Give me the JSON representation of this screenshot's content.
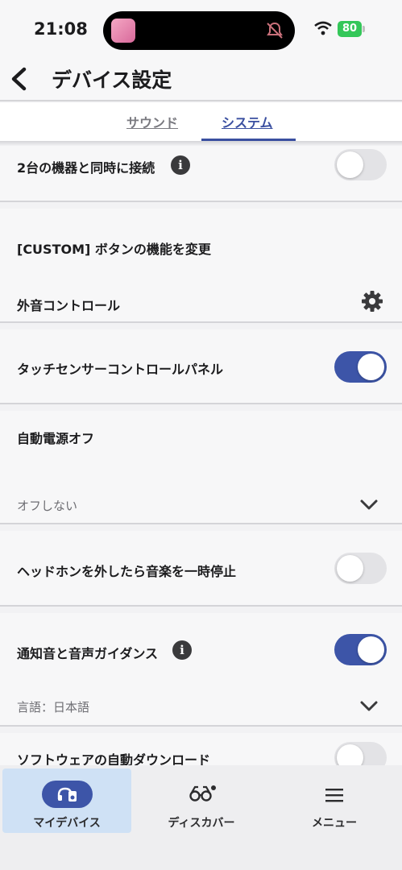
{
  "status_bar": {
    "time": "21:08",
    "battery": "80"
  },
  "header": {
    "title": "デバイス設定"
  },
  "tabs": [
    {
      "label": "サウンド",
      "active": false
    },
    {
      "label": "システム",
      "active": true
    }
  ],
  "settings": {
    "dual_connect": {
      "label": "2台の機器と同時に接続",
      "enabled": false
    },
    "custom_button": {
      "label": "[CUSTOM] ボタンの機能を変更"
    },
    "ambient_control": {
      "label": "外音コントロール"
    },
    "touch_panel": {
      "label": "タッチセンサーコントロールパネル",
      "enabled": true
    },
    "auto_power_off": {
      "label": "自動電源オフ",
      "value": "オフしない"
    },
    "pause_on_remove": {
      "label": "ヘッドホンを外したら音楽を一時停止",
      "enabled": false
    },
    "notification_voice": {
      "label": "通知音と音声ガイダンス",
      "enabled": true,
      "language": "言語：日本語"
    },
    "software_download": {
      "label": "ソフトウェアの自動ダウンロード",
      "enabled": false
    }
  },
  "bottom_nav": [
    {
      "label": "マイデバイス",
      "icon": "headphones-icon",
      "active": true
    },
    {
      "label": "ディスカバー",
      "icon": "binoculars-icon",
      "active": false
    },
    {
      "label": "メニュー",
      "icon": "menu-icon",
      "active": false
    }
  ],
  "colors": {
    "accent": "#3d55a8",
    "toggle_off": "#e3e3e6",
    "active_nav_bg": "#cfe1f5",
    "battery": "#34c759"
  }
}
